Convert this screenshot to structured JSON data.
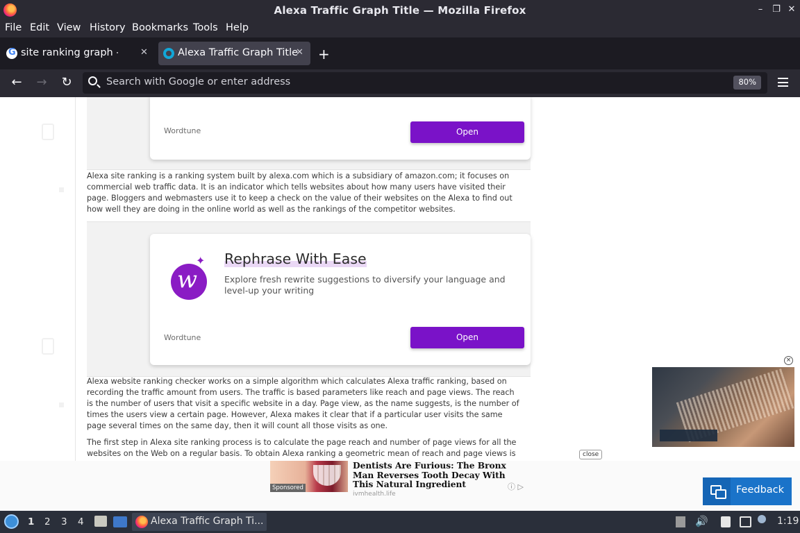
{
  "window": {
    "title": "Alexa Traffic Graph Title — Mozilla Firefox",
    "controls": [
      "–",
      "❐",
      "✕"
    ]
  },
  "menu": [
    "File",
    "Edit",
    "View",
    "History",
    "Bookmarks",
    "Tools",
    "Help"
  ],
  "tabs": [
    {
      "label": "site ranking graph - Goo",
      "active": false,
      "icon": "google-icon"
    },
    {
      "label": "Alexa Traffic Graph Title",
      "active": true,
      "icon": "site-icon"
    }
  ],
  "nav": {
    "placeholder": "Search with Google or enter address",
    "zoom": "80%"
  },
  "article": {
    "ad1": {
      "brand": "Wordtune",
      "button": "Open"
    },
    "para1": "Alexa site ranking is a ranking system built by alexa.com which is a subsidiary of amazon.com; it focuses on commercial web traffic data. It is an indicator which tells websites about how many users have visited their page. Bloggers and webmasters use it to keep a check on the value of their websites on the Alexa to find out how well they are doing in the online world as well as the rankings of the competitor websites.",
    "ad2": {
      "title": "Rephrase With Ease",
      "desc": "Explore fresh rewrite suggestions to diversify your language and level-up your writing",
      "brand": "Wordtune",
      "button": "Open"
    },
    "para2": "Alexa website ranking checker works on a simple algorithm which calculates Alexa traffic ranking, based on recording the traffic amount from users. The traffic is based parameters like reach and page views. The reach is the number of users that visit a specific website in a day. Page view, as the name suggests, is the number of times the users view a certain page. However, Alexa makes it clear that if a particular user visits the same page several times on the same day, then it will count all those visits as one.",
    "para3": "The first step in Alexa site ranking process is to calculate the page reach and number of page views for all the websites on the Web on a regular basis. To obtain Alexa ranking a geometric mean of reach and page views is"
  },
  "video_close": "×",
  "close_label": "close",
  "bottom_ad": {
    "sponsored": "Sponsored",
    "headline": "Dentists Are Furious: The Bronx Man Reverses Tooth Decay With This Natural Ingredient",
    "source": "ivmhealth.life",
    "choices": "ⓘ ▷"
  },
  "feedback": "Feedback",
  "taskbar": {
    "workspaces": [
      "1",
      "2",
      "3",
      "4"
    ],
    "task": "Alexa Traffic Graph Ti...",
    "clock": "1:19"
  }
}
